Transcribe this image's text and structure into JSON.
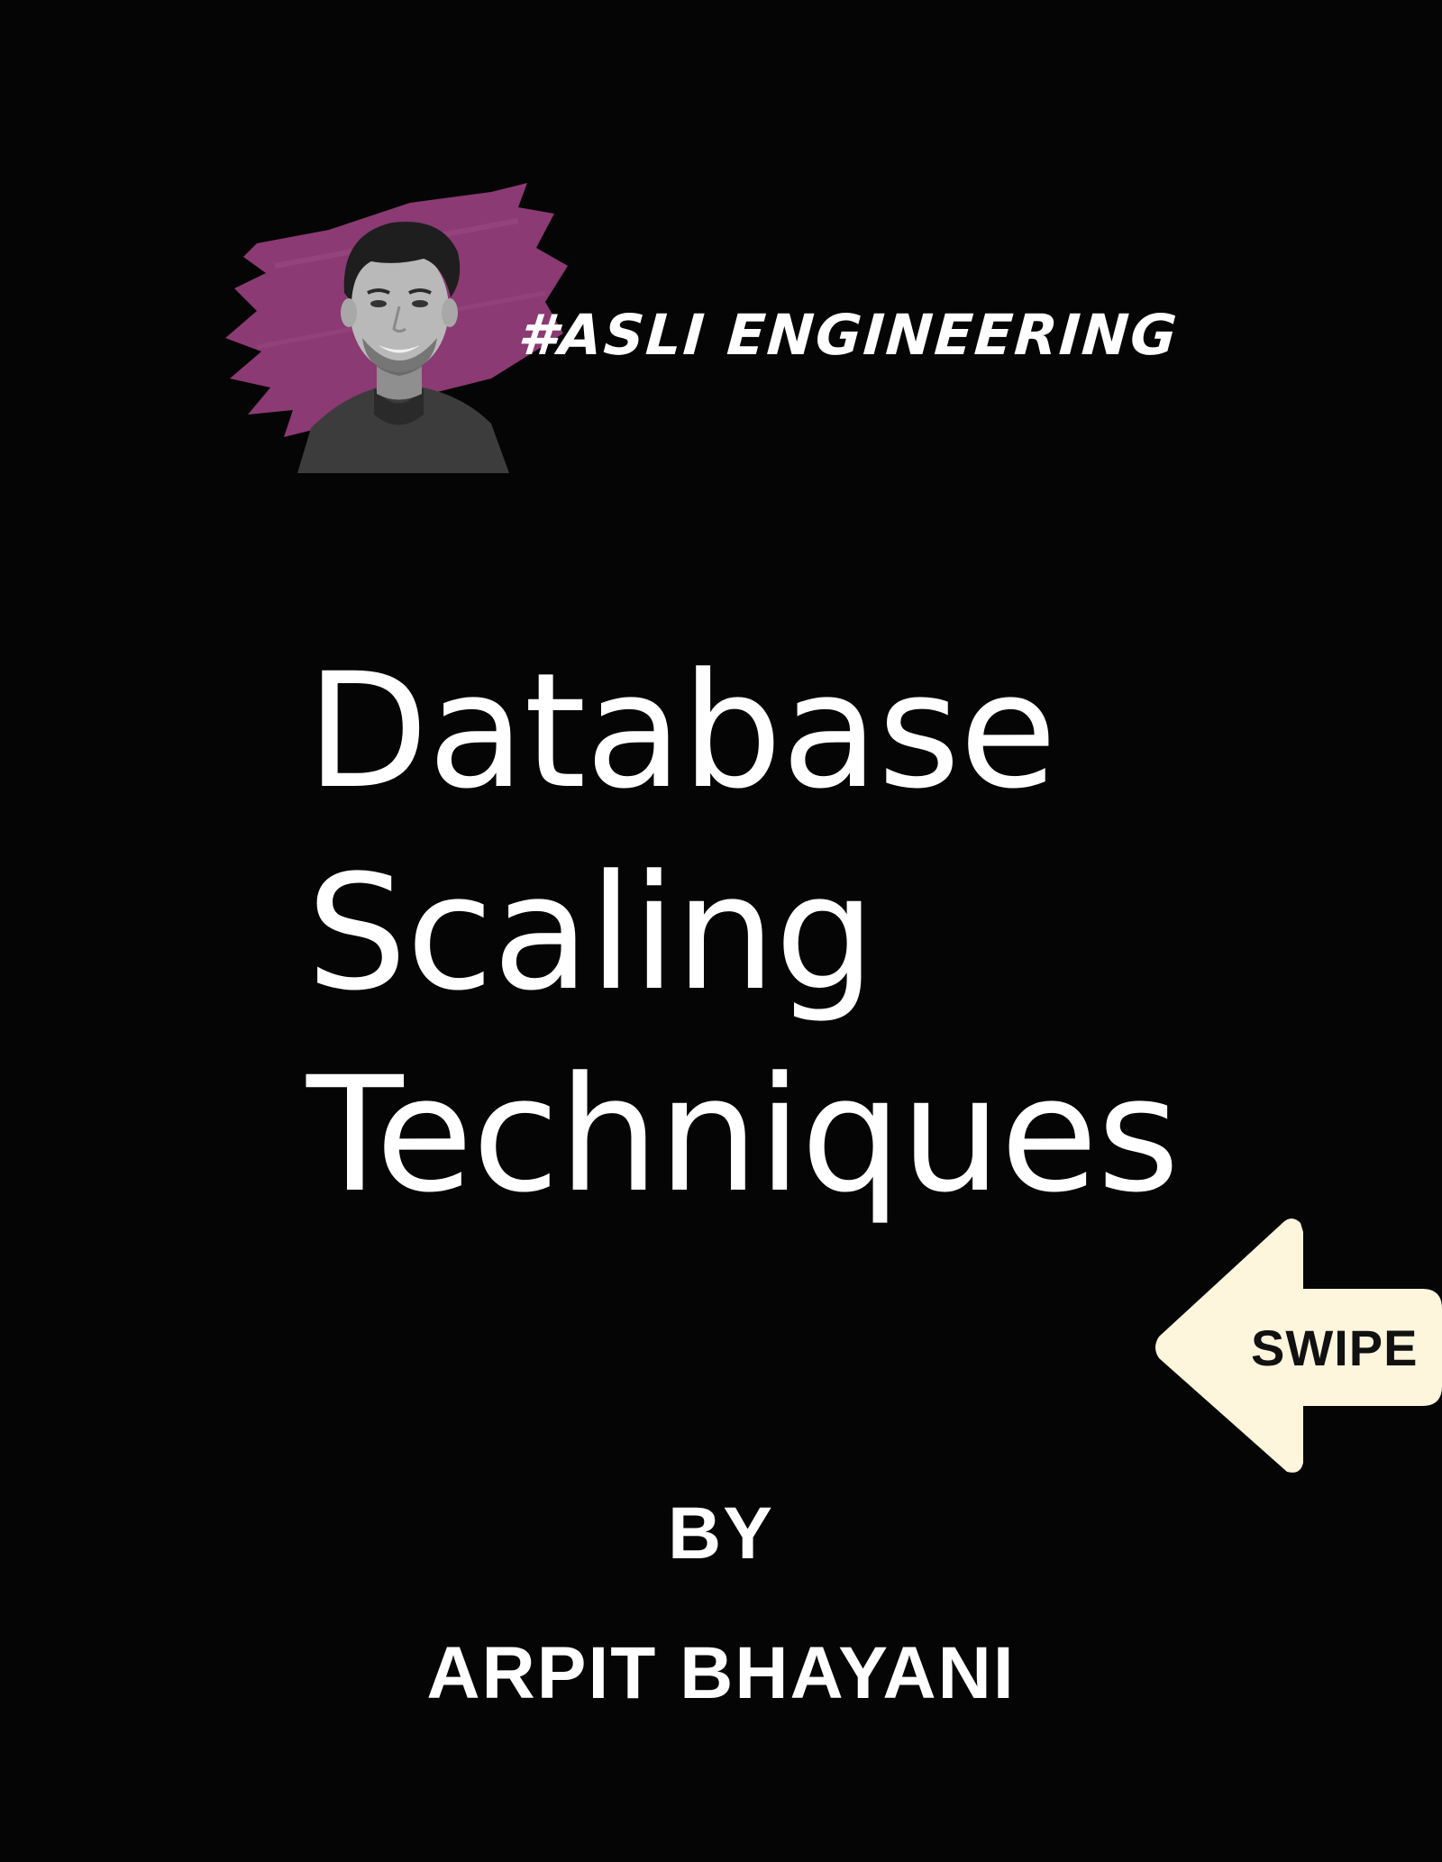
{
  "header": {
    "hashtag": "#ASLI ENGINEERING",
    "brush_color": "#8b3a73",
    "avatar_icon": "person-portrait-icon"
  },
  "title": {
    "line1": "Database",
    "line2": "Scaling",
    "line3": "Techniques"
  },
  "swipe": {
    "label": "SWIPE",
    "color": "#fdf5dc",
    "icon": "arrow-left-icon"
  },
  "byline": {
    "by": "BY",
    "author": "ARPIT BHAYANI"
  }
}
